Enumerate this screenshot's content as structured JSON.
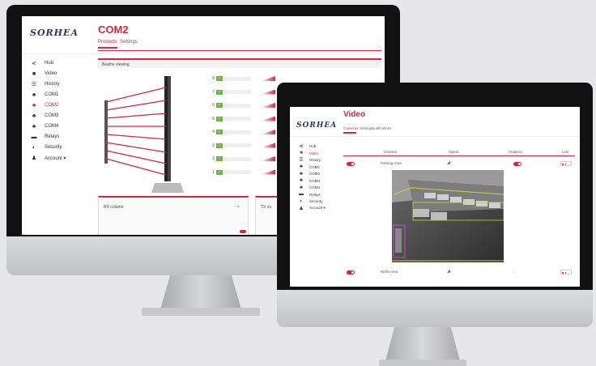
{
  "back_app": {
    "logo": "SORHEA",
    "title": "COM2",
    "tabs": [
      {
        "label": "Products",
        "active": true
      },
      {
        "label": "Settings",
        "active": false
      }
    ],
    "sidebar": [
      {
        "label": "Hub",
        "icon": "hub-icon",
        "active": false
      },
      {
        "label": "Video",
        "icon": "video-camera-icon",
        "active": false
      },
      {
        "label": "History",
        "icon": "list-icon",
        "active": false
      },
      {
        "label": "COM1",
        "icon": "network-icon",
        "active": false
      },
      {
        "label": "COM2",
        "icon": "network-icon",
        "active": true
      },
      {
        "label": "COM3",
        "icon": "network-icon",
        "active": false
      },
      {
        "label": "COM4",
        "icon": "network-icon",
        "active": false
      },
      {
        "label": "Relays",
        "icon": "relay-icon",
        "active": false
      },
      {
        "label": "Security",
        "icon": "shield-icon",
        "active": false
      },
      {
        "label": "Account ▾",
        "icon": "user-icon",
        "active": false
      }
    ],
    "panel_title": "Beams viewing",
    "beams": [
      "8",
      "7",
      "6",
      "5",
      "4",
      "3",
      "2",
      "1"
    ],
    "rx_column": "RX column",
    "tx_column": "TX co"
  },
  "front_app": {
    "logo": "SORHEA",
    "title": "Video",
    "tabs": [
      {
        "label": "Cameras",
        "active": true
      },
      {
        "label": "Settings",
        "active": false
      },
      {
        "label": "Notifications",
        "active": false
      }
    ],
    "sidebar": [
      {
        "label": "Hub",
        "icon": "hub-icon",
        "active": false
      },
      {
        "label": "Video",
        "icon": "video-camera-icon",
        "active": true
      },
      {
        "label": "History",
        "icon": "list-icon",
        "active": false
      },
      {
        "label": "COM1",
        "icon": "network-icon",
        "active": false
      },
      {
        "label": "COM2",
        "icon": "network-icon",
        "active": false
      },
      {
        "label": "COM3",
        "icon": "network-icon",
        "active": false
      },
      {
        "label": "COM4",
        "icon": "network-icon",
        "active": false
      },
      {
        "label": "Relays",
        "icon": "relay-icon",
        "active": false
      },
      {
        "label": "Security",
        "icon": "shield-icon",
        "active": false
      },
      {
        "label": "Account ▾",
        "icon": "user-icon",
        "active": false
      }
    ],
    "table_headers": [
      "Camera",
      "Signal",
      "Analysis",
      "Live"
    ],
    "rows": [
      {
        "name": "Parking Area"
      },
      {
        "name": "North Area"
      }
    ]
  },
  "colors": {
    "accent": "#d7263d",
    "ok_green": "#6db33f",
    "bezel": "#111111"
  }
}
